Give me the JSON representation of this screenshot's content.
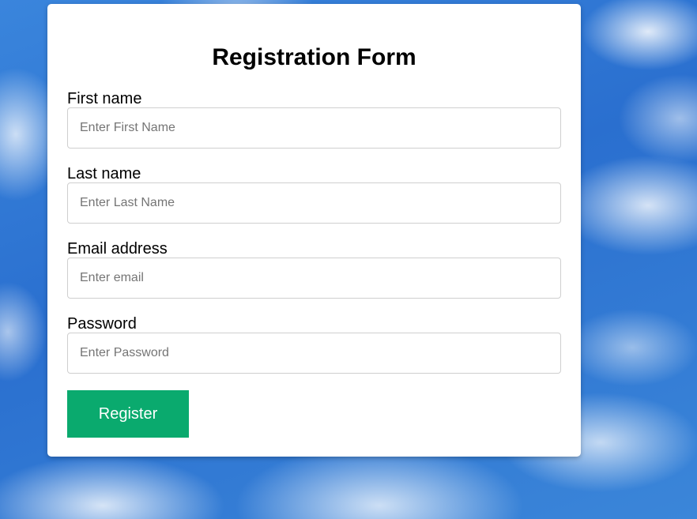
{
  "form": {
    "title": "Registration Form",
    "fields": [
      {
        "label": "First name",
        "placeholder": "Enter First Name",
        "value": ""
      },
      {
        "label": "Last name",
        "placeholder": "Enter Last Name",
        "value": ""
      },
      {
        "label": "Email address",
        "placeholder": "Enter email",
        "value": ""
      },
      {
        "label": "Password",
        "placeholder": "Enter Password",
        "value": ""
      }
    ],
    "submit_label": "Register"
  },
  "colors": {
    "background_sky": "#2f78d6",
    "card": "#ffffff",
    "button": "#0aaa6e",
    "button_text": "#ffffff",
    "input_border": "#cfcfcf"
  }
}
